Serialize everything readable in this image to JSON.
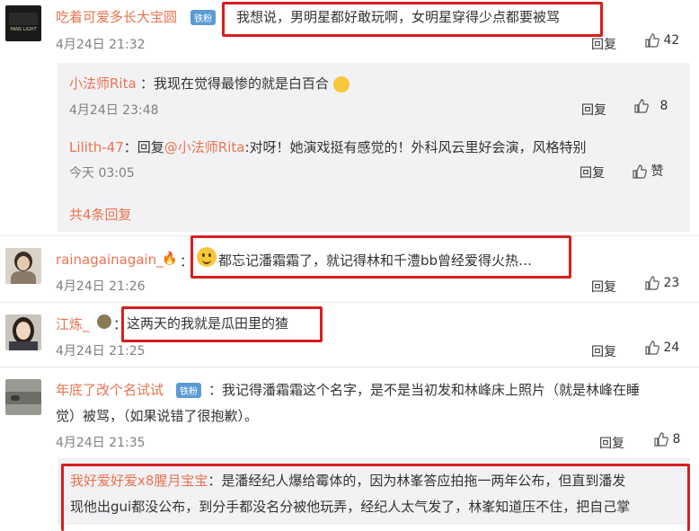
{
  "comments": [
    {
      "user": "吃着可爱多长大宝圆",
      "badge": "铁粉",
      "text": "我想说，男明星都好敢玩啊，女明星穿得少点都要被骂",
      "time": "4月24日 21:32",
      "reply": "回复",
      "likes": "42"
    },
    {
      "user": "rainagainagain_",
      "text_prefix": "：",
      "text": "都忘记潘霜霜了，就记得林和千澧bb曾经爱得火热…",
      "time": "4月24日 21:26",
      "reply": "回复",
      "likes": "23"
    },
    {
      "user": "江炼_",
      "text_prefix": "：",
      "text": "这两天的我就是瓜田里的猹",
      "time": "4月24日 21:25",
      "reply": "回复",
      "likes": "24"
    },
    {
      "user": "年底了改个名试试",
      "badge": "铁粉",
      "text_line1": "：我记得潘霜霜这个名字，是不是当初发和林峰床上照片（就是林峰在睡",
      "text_line2": "觉）被骂，（如果说错了很抱歉）。",
      "time": "4月24日 21:35",
      "reply": "回复",
      "likes": "8"
    },
    {
      "user": "我好爱好爱x8腥月宝宝",
      "text_line1": "：是潘经纪人爆给霉体的，因为林峯答应拍拖一两年公布，但直到潘发",
      "text_line2": "现他出gui都没公布，到分手都没名分被他玩弄，经纪人太气发了，林峯知道压不住，把自己掌"
    }
  ],
  "replies": [
    {
      "user": "小法师Rita",
      "text": "：我现在觉得最惨的就是白百合",
      "time": "4月24日 23:48",
      "reply": "回复",
      "likes": "8"
    },
    {
      "user": "Lilith-47",
      "text_a": "：回复",
      "mention": "@小法师Rita",
      "text_b": ":对呀！她演戏挺有感觉的！外科风云里好会演，风格特别",
      "time": "今天 03:05",
      "reply": "回复",
      "likes": "赞"
    }
  ],
  "more_replies": "共4条回复",
  "avatar_caption": "FANS LIGHT",
  "colors": {
    "name": "#eb7350",
    "highlight": "#d81e1e",
    "panel": "#f2f2f5",
    "meta": "#808080"
  }
}
